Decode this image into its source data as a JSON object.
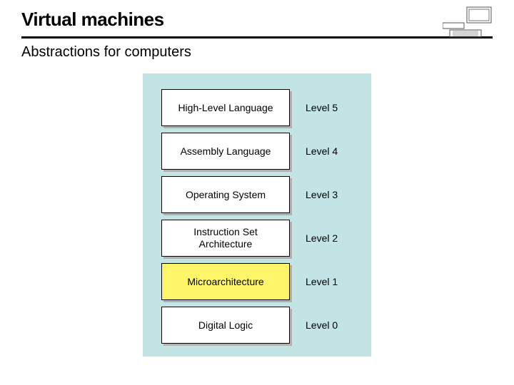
{
  "title": "Virtual machines",
  "subtitle": "Abstractions for computers",
  "layers": [
    {
      "name": "High-Level Language",
      "level": "Level 5",
      "highlight": false
    },
    {
      "name": "Assembly Language",
      "level": "Level 4",
      "highlight": false
    },
    {
      "name": "Operating System",
      "level": "Level 3",
      "highlight": false
    },
    {
      "name": "Instruction Set Architecture",
      "level": "Level 2",
      "highlight": false
    },
    {
      "name": "Microarchitecture",
      "level": "Level 1",
      "highlight": true
    },
    {
      "name": "Digital Logic",
      "level": "Level 0",
      "highlight": false
    }
  ],
  "colors": {
    "panel_bg": "#c2e4e4",
    "highlight": "#fff56a"
  }
}
